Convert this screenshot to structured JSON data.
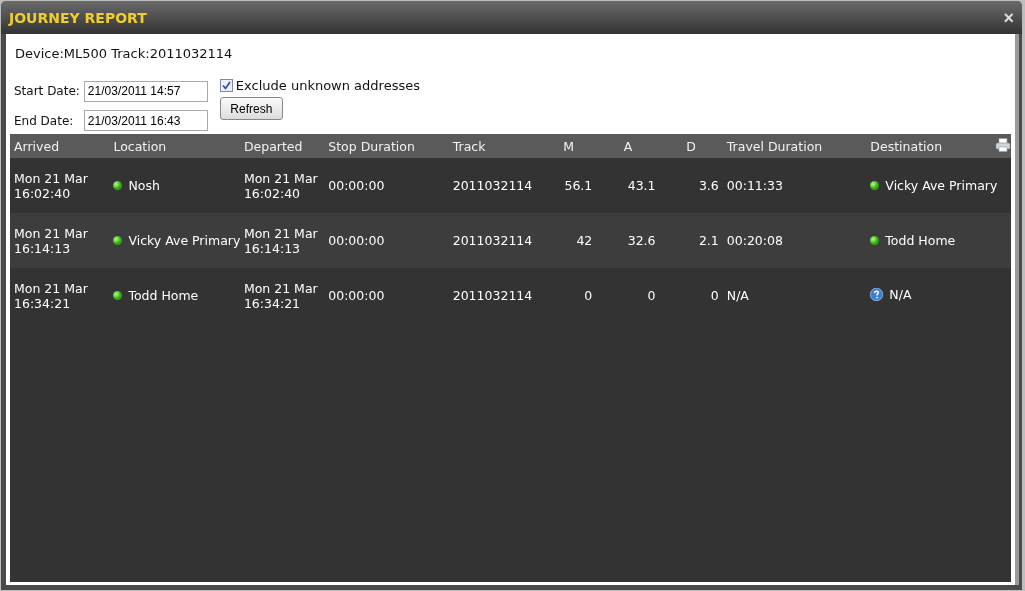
{
  "window": {
    "title": "JOURNEY REPORT",
    "close": "×"
  },
  "info": "Device:ML500 Track:2011032114",
  "form": {
    "start_label": "Start Date:",
    "start_value": "21/03/2011 14:57",
    "end_label": "End Date:",
    "end_value": "21/03/2011 16:43",
    "exclude": {
      "label": "Exclude unknown addresses",
      "checked": true
    },
    "refresh": "Refresh"
  },
  "table": {
    "columns": [
      "Arrived",
      "Location",
      "Departed",
      "Stop Duration",
      "Track",
      "M",
      "A",
      "D",
      "Travel Duration",
      "Destination"
    ],
    "rows": [
      {
        "arrived": [
          "Mon 21 Mar",
          "16:02:40"
        ],
        "location": {
          "name": "Nosh",
          "kind": "known"
        },
        "departed": [
          "Mon 21 Mar",
          "16:02:40"
        ],
        "stop": "00:00:00",
        "track": "2011032114",
        "m": "56.1",
        "a": "43.1",
        "d": "3.6",
        "travel": "00:11:33",
        "destination": {
          "name": "Vicky Ave Primary",
          "kind": "known"
        }
      },
      {
        "arrived": [
          "Mon 21 Mar",
          "16:14:13"
        ],
        "location": {
          "name": "Vicky Ave Primary",
          "kind": "known"
        },
        "departed": [
          "Mon 21 Mar",
          "16:14:13"
        ],
        "stop": "00:00:00",
        "track": "2011032114",
        "m": "42",
        "a": "32.6",
        "d": "2.1",
        "travel": "00:20:08",
        "destination": {
          "name": "Todd Home",
          "kind": "known"
        }
      },
      {
        "arrived": [
          "Mon 21 Mar",
          "16:34:21"
        ],
        "location": {
          "name": "Todd Home",
          "kind": "known"
        },
        "departed": [
          "Mon 21 Mar",
          "16:34:21"
        ],
        "stop": "00:00:00",
        "track": "2011032114",
        "m": "0",
        "a": "0",
        "d": "0",
        "travel": "N/A",
        "destination": {
          "name": "N/A",
          "kind": "unknown"
        }
      }
    ]
  }
}
